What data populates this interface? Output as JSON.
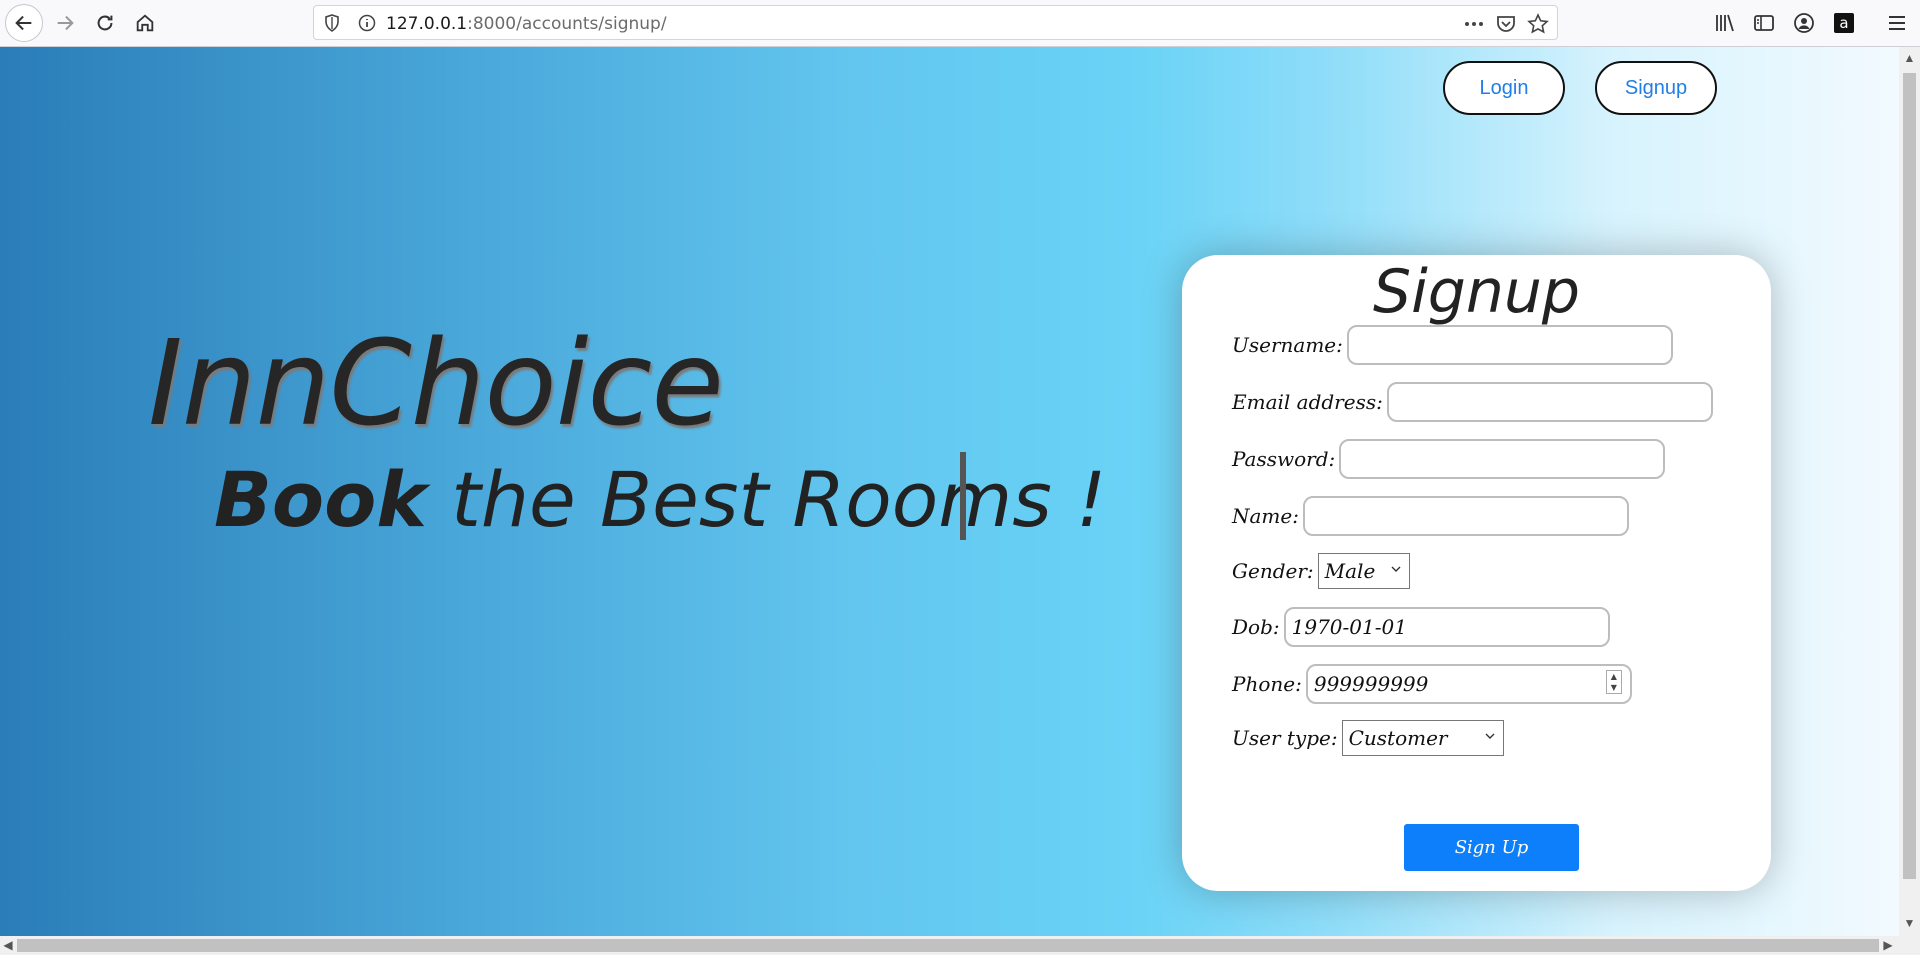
{
  "browser": {
    "url_host": "127.0.0.1",
    "url_path": ":8000/accounts/signup/"
  },
  "nav": {
    "login_label": "Login",
    "signup_label": "Signup"
  },
  "hero": {
    "brand": "InnChoice",
    "tagline_strong": "Book",
    "tagline_rest": " the Best Rooms !"
  },
  "form": {
    "title": "Signup",
    "username_label": "Username:",
    "username_value": "",
    "email_label": "Email address:",
    "email_value": "",
    "password_label": "Password:",
    "password_value": "",
    "name_label": "Name:",
    "name_value": "",
    "gender_label": "Gender:",
    "gender_value": "Male",
    "dob_label": "Dob:",
    "dob_value": "1970-01-01",
    "phone_label": "Phone:",
    "phone_value": "999999999",
    "user_type_label": "User type:",
    "user_type_value": "Customer",
    "submit_label": "Sign Up"
  },
  "colors": {
    "accent": "#0d7ffa",
    "nav_link": "#1f7fe6",
    "gradient_start": "#2a7db8",
    "gradient_end": "#f2faff"
  }
}
